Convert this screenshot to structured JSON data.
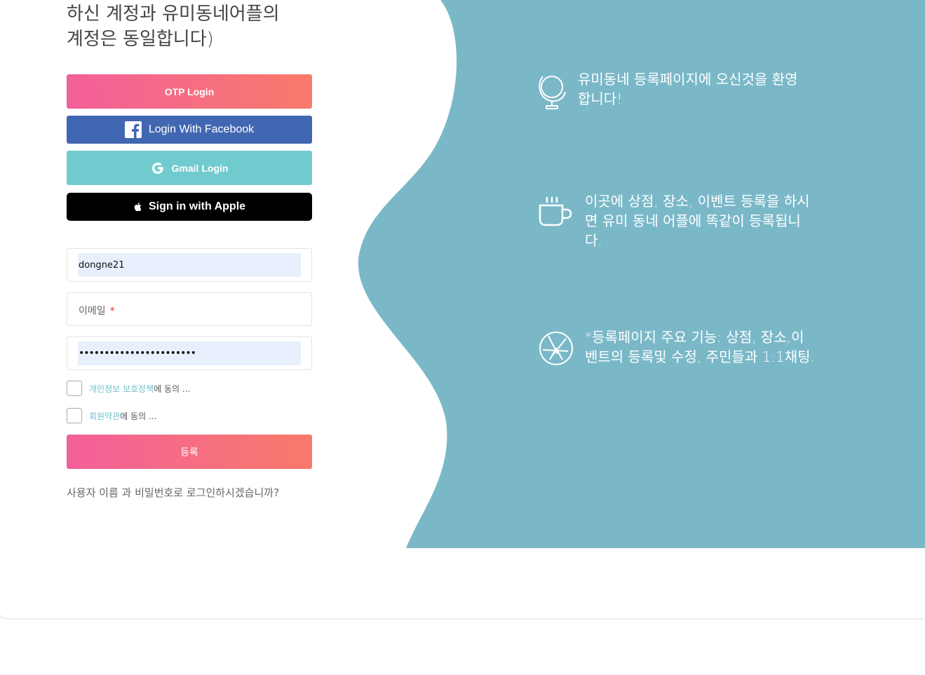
{
  "intro": {
    "line1": "하신 계정과 유미동네어플의",
    "line2": "계정은 동일합니다)"
  },
  "social": {
    "otp_label": "OTP Login",
    "facebook_label": "Login With Facebook",
    "gmail_label": "Gmail Login",
    "apple_label": "Sign in with Apple"
  },
  "form": {
    "username_value": "dongne21",
    "email_placeholder": "이메일",
    "email_required_mark": "*",
    "password_value": "•••••••••••••••••••••••",
    "privacy_link": "개인정보 보호정책",
    "privacy_suffix": "에 동의 ...",
    "terms_link": "회원약관",
    "terms_suffix": "에 동의 ...",
    "submit_label": "등록"
  },
  "footer": {
    "question": "사용자 이름 과 비밀번호로 로그인하시겠습니까?"
  },
  "features": [
    {
      "icon": "globe-icon",
      "text": "유미동네 등록페이지에 오신것을 환영합니다!"
    },
    {
      "icon": "coffee-cup-icon",
      "text": "이곳에 상점, 장소, 이벤트 등록을 하시면 유미 동네 어플에 똑같이 등록됩니다."
    },
    {
      "icon": "aperture-icon",
      "text": "*등록페이지 주요 기능: 상점, 장소,이벤트의 등록및 수정, 주민들과 1:1채팅."
    }
  ],
  "colors": {
    "panel": "#7ab8c8",
    "gradient_start": "#f3609a",
    "gradient_end": "#f87a6a",
    "facebook": "#4267b2",
    "gmail": "#70cbcf",
    "apple": "#000000",
    "input_fill": "#e8f0fe"
  }
}
